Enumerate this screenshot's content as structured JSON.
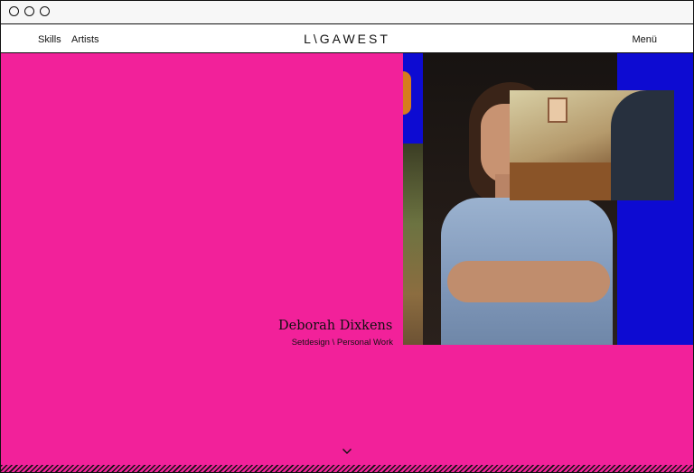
{
  "nav": {
    "logo": "L\\GAWEST",
    "links": [
      {
        "label": "Skills"
      },
      {
        "label": "Artists"
      }
    ],
    "menu_label": "Menü"
  },
  "hero": {
    "artist_name": "Deborah Dixkens",
    "artist_subtitle": "Setdesign \\ Personal Work",
    "colors": {
      "background": "#f2219a",
      "accent_block": "#0d0bd2"
    }
  },
  "icons": {
    "scroll_down": "chevron-down-icon"
  }
}
